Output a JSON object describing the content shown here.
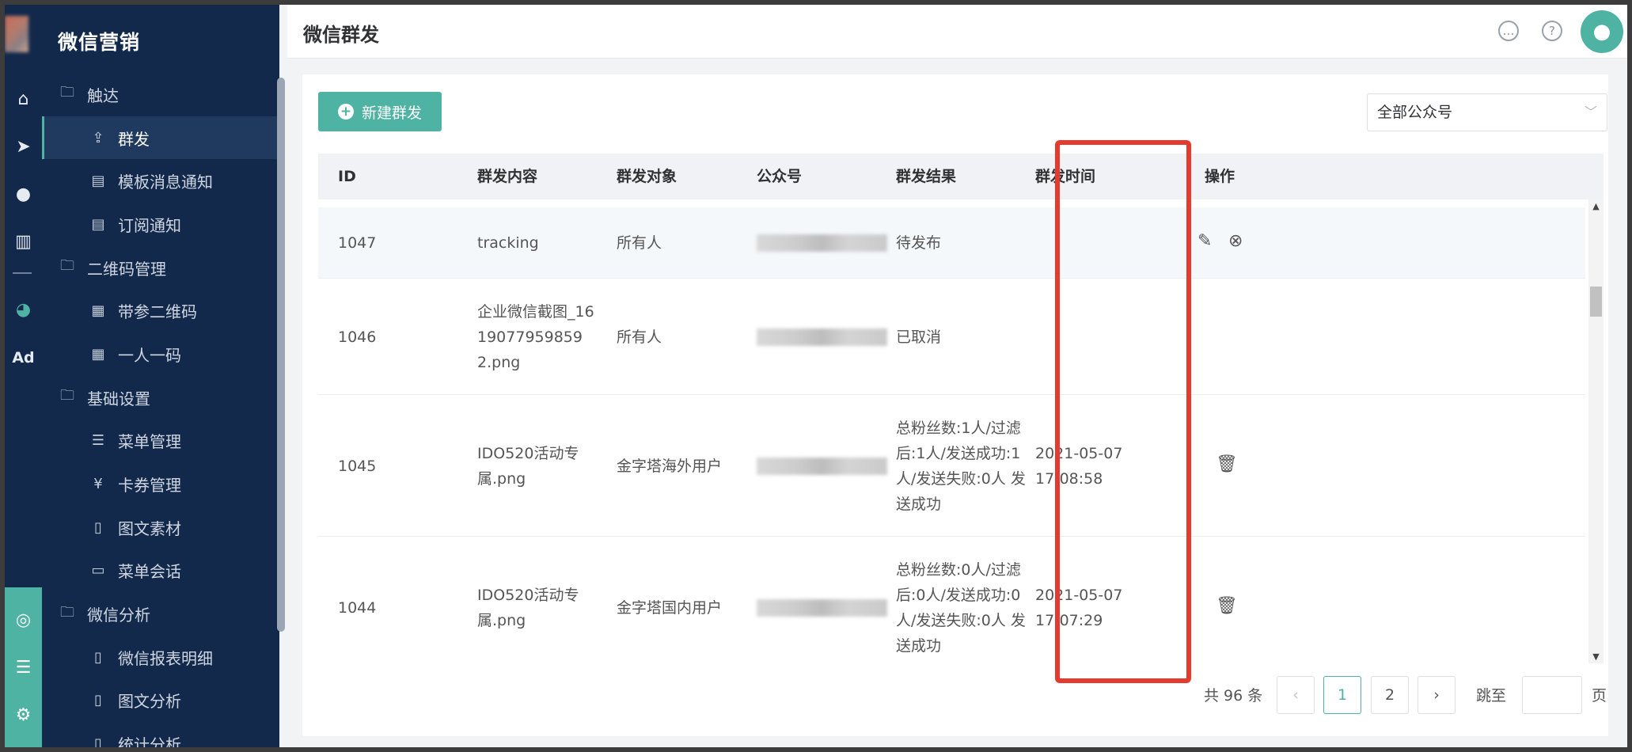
{
  "sidebar": {
    "title": "微信营销",
    "items": [
      {
        "label": "触达",
        "icon": "folder-icon",
        "level": "group"
      },
      {
        "label": "群发",
        "icon": "send-box-icon",
        "level": "sub",
        "active": true
      },
      {
        "label": "模板消息通知",
        "icon": "message-template-icon",
        "level": "sub"
      },
      {
        "label": "订阅通知",
        "icon": "subscribe-icon",
        "level": "sub"
      },
      {
        "label": "二维码管理",
        "icon": "folder-icon",
        "level": "group"
      },
      {
        "label": "带参二维码",
        "icon": "qrcode-icon",
        "level": "sub"
      },
      {
        "label": "一人一码",
        "icon": "qrcode-icon",
        "level": "sub"
      },
      {
        "label": "基础设置",
        "icon": "folder-icon",
        "level": "group"
      },
      {
        "label": "菜单管理",
        "icon": "list-icon",
        "level": "sub"
      },
      {
        "label": "卡券管理",
        "icon": "coupon-icon",
        "level": "sub"
      },
      {
        "label": "图文素材",
        "icon": "document-icon",
        "level": "sub"
      },
      {
        "label": "菜单会话",
        "icon": "chat-icon",
        "level": "sub"
      },
      {
        "label": "微信分析",
        "icon": "folder-icon",
        "level": "group"
      },
      {
        "label": "微信报表明细",
        "icon": "document-icon",
        "level": "sub"
      },
      {
        "label": "图文分析",
        "icon": "document-icon",
        "level": "sub"
      },
      {
        "label": "统计分析",
        "icon": "document-icon",
        "level": "sub"
      }
    ]
  },
  "rail": {
    "ad_label": "Ad"
  },
  "header": {
    "title": "微信群发"
  },
  "toolbar": {
    "new_label": "新建群发",
    "account_select": "全部公众号"
  },
  "table": {
    "headers": [
      "ID",
      "群发内容",
      "群发对象",
      "公众号",
      "群发结果",
      "群发时间",
      "操作"
    ],
    "rows": [
      {
        "id": "1047",
        "content": "tracking",
        "target": "所有人",
        "result": "待发布",
        "time": "",
        "actions": [
          "edit",
          "cancel"
        ]
      },
      {
        "id": "1046",
        "content": "企业微信截图_16190779598592.png",
        "target": "所有人",
        "result": "已取消",
        "time": "",
        "actions": []
      },
      {
        "id": "1045",
        "content": "IDO520活动专属.png",
        "target": "金字塔海外用户",
        "result": "总粉丝数:1人/过滤后:1人/发送成功:1人/发送失败:0人 发送成功",
        "time": "2021-05-07 17:08:58",
        "actions": [
          "delete"
        ]
      },
      {
        "id": "1044",
        "content": "IDO520活动专属.png",
        "target": "金字塔国内用户",
        "result": "总粉丝数:0人/过滤后:0人/发送成功:0人/发送失败:0人 发送成功",
        "time": "2021-05-07 17:07:29",
        "actions": [
          "delete"
        ]
      }
    ]
  },
  "pagination": {
    "total": "共 96 条",
    "pages": [
      "1",
      "2"
    ],
    "current": "1",
    "jump_label": "跳至",
    "jump_unit": "页"
  },
  "colors": {
    "sidebar_bg": "#13294b",
    "accent": "#4fb3a3",
    "highlight_box": "#e53b2e"
  }
}
